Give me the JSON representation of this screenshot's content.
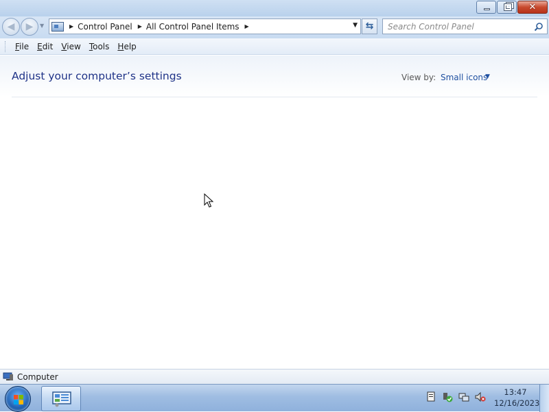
{
  "window": {
    "caption_buttons": {
      "minimize_icon": "minimize-icon",
      "restore_icon": "restore-icon",
      "close_icon": "close-icon",
      "close_glyph": "✕"
    }
  },
  "navigation": {
    "back_icon": "back-arrow-icon",
    "forward_icon": "forward-arrow-icon",
    "breadcrumb": [
      "Control Panel",
      "All Control Panel Items"
    ],
    "search_placeholder": "Search Control Panel"
  },
  "menubar": {
    "items": [
      {
        "label": "File",
        "accel": "F",
        "rest": "ile"
      },
      {
        "label": "Edit",
        "accel": "E",
        "rest": "dit"
      },
      {
        "label": "View",
        "accel": "V",
        "rest": "iew"
      },
      {
        "label": "Tools",
        "accel": "T",
        "rest": "ools"
      },
      {
        "label": "Help",
        "accel": "H",
        "rest": "elp"
      }
    ]
  },
  "content": {
    "title": "Adjust your computer’s settings",
    "view_by_label": "View by:",
    "view_by_value": "Small icons"
  },
  "statusbar": {
    "text": "Computer"
  },
  "taskbar": {
    "clock_time": "13:47",
    "clock_date": "12/16/2023",
    "tray_icons": [
      "action-center-icon",
      "network-icon",
      "volume-muted-icon"
    ]
  },
  "colors": {
    "title_text": "#1e3287",
    "link_blue": "#1e4fa0",
    "taskbar": "#9fbde2"
  }
}
